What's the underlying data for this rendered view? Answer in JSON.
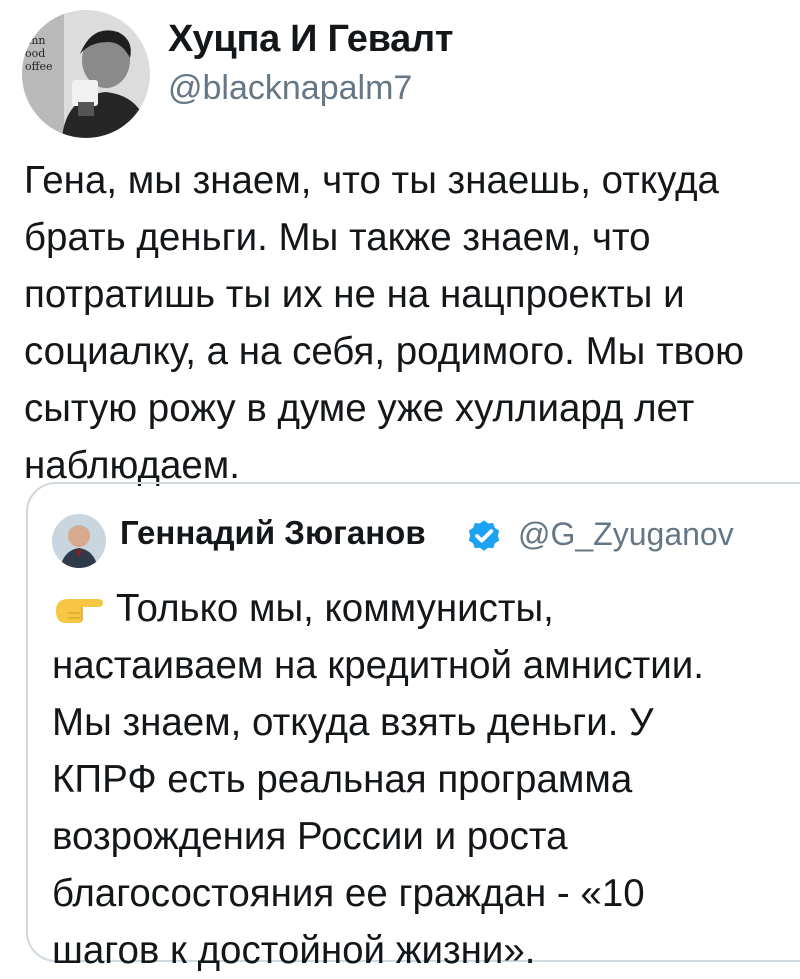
{
  "tweet": {
    "author": {
      "name": "Хуцпа И Гевалт",
      "handle": "@blacknapalm7",
      "avatar_icon": "user-avatar",
      "avatar_text": [
        "mn",
        "ood",
        "offee"
      ]
    },
    "text_lines": [
      "Гена, мы знаем, что ты знаешь, откуда",
      "брать деньги. Мы также знаем, что",
      "потратишь ты их не на нацпроекты и",
      "социалку, а на себя, родимого. Мы твою",
      "сытую рожу в думе уже хуллиард лет",
      "наблюдаем."
    ]
  },
  "quoted_tweet": {
    "author": {
      "name": "Геннадий Зюганов",
      "handle": "@G_Zyuganov",
      "verified": true,
      "avatar_icon": "user-avatar"
    },
    "emoji_icon": "pointing-hand-icon",
    "text_lines": [
      "Только мы, коммунисты,",
      "настаиваем на кредитной амнистии.",
      "Мы знаем, откуда взять деньги. У",
      "КПРФ есть реальная программа",
      "возрождения России и роста",
      "благосостояния ее граждан - «10",
      "шагов к достойной жизни»."
    ]
  },
  "colors": {
    "text": "#14171a",
    "secondary_text": "#657786",
    "verified": "#1da1f2",
    "border": "#cfd9de",
    "emoji": "#f7c744"
  }
}
